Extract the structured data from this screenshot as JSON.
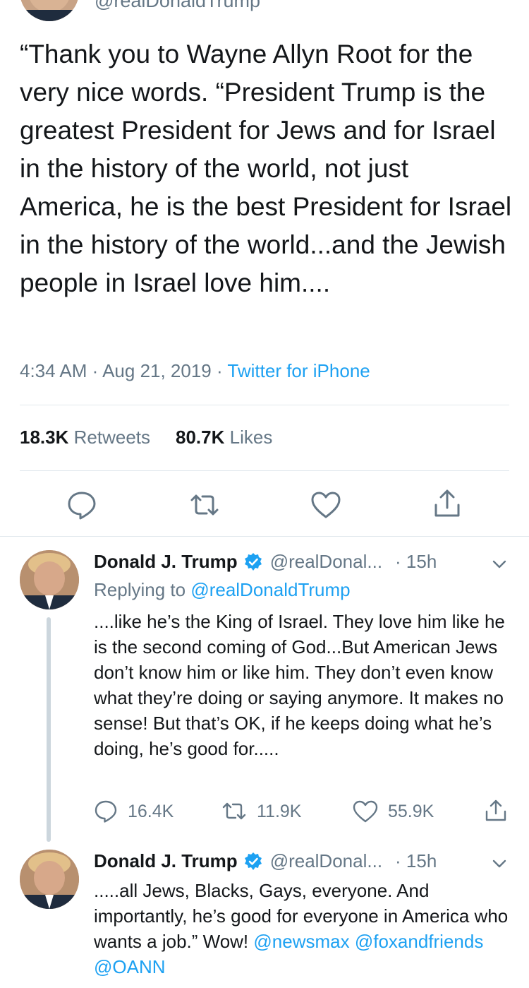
{
  "top_tweet": {
    "handle": "@realDonaldTrump",
    "text": "“Thank you to Wayne Allyn Root for the very nice words. “President Trump is the greatest President for Jews and for Israel in the history of the world, not just America, he is the best President for Israel in the history of the world...and the Jewish people in Israel love him....",
    "time": "4:34 AM",
    "sep1": " · ",
    "date": "Aug 21, 2019",
    "sep2": " · ",
    "source": "Twitter for iPhone",
    "retweets_count": "18.3K",
    "retweets_label": "Retweets",
    "likes_count": "80.7K",
    "likes_label": "Likes",
    "actions": [
      "reply-icon",
      "retweet-icon",
      "like-icon",
      "share-icon"
    ]
  },
  "replies": [
    {
      "name": "Donald J. Trump",
      "handle": "@realDonal...",
      "time": "· 15h",
      "replying_prefix": "Replying to ",
      "replying_to": "@realDonaldTrump",
      "text": "....like he’s the King of Israel. They love him like he is the second coming of God...But American Jews don’t know him or like him. They don’t even know what they’re doing or saying anymore. It makes no sense! But that’s OK, if he keeps doing what he’s doing, he’s good for.....",
      "reply_count": "16.4K",
      "retweet_count": "11.9K",
      "like_count": "55.9K"
    },
    {
      "name": "Donald J. Trump",
      "handle": "@realDonal...",
      "time": "· 15h",
      "text": ".....all Jews, Blacks, Gays, everyone. And importantly, he’s good for everyone in America who wants a job.” Wow! ",
      "mention1": "@newsmax",
      "mention2": "@foxandfriends",
      "mention3": "@OANN"
    }
  ],
  "colors": {
    "accent": "#1da1f2",
    "text": "#14171a",
    "secondary": "#657786",
    "divider": "#e1e8ed"
  }
}
